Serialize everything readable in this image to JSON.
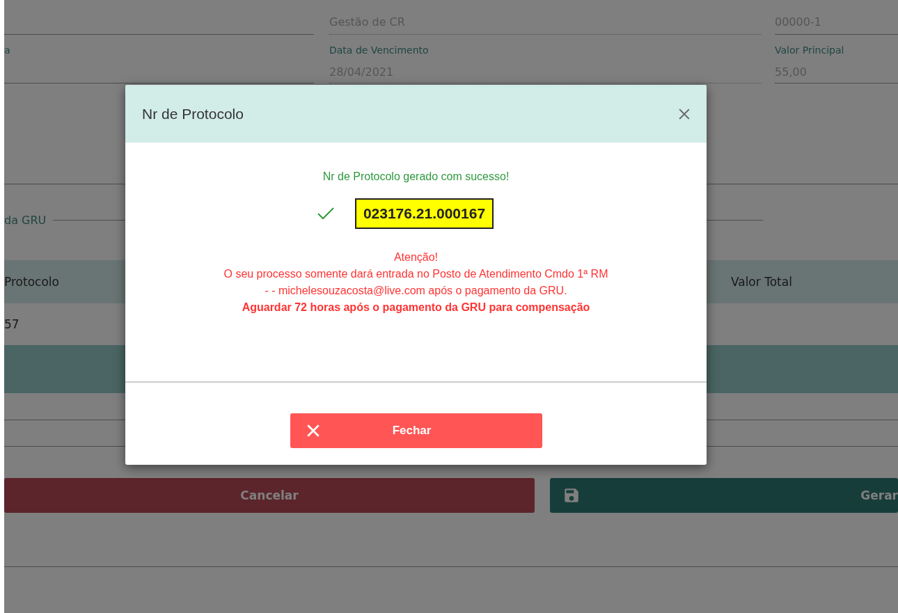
{
  "background_form": {
    "row_1": [
      {
        "value": "Gestão de CR"
      },
      {
        "value": "00000-1"
      }
    ],
    "row_2": [
      {
        "label": "a"
      },
      {
        "label": "Data de Vencimento",
        "value": "28/04/2021"
      },
      {
        "label": "Valor Principal",
        "value": "55,00"
      }
    ],
    "section_legend": "da GRU",
    "table": {
      "columns": [
        "Protocolo",
        "Valor Total"
      ],
      "rows": [
        [
          "57"
        ]
      ]
    },
    "buttons": [
      {
        "kind": "cancel",
        "label": "Cancelar"
      },
      {
        "kind": "save",
        "label": "Gerar"
      }
    ]
  },
  "modal": {
    "title": "Nr de Protocolo",
    "success_message": "Nr de Protocolo gerado com sucesso!",
    "protocol_number": "023176.21.000167",
    "warning_lines": [
      "Atenção!",
      "O seu processo somente dará entrada no Posto de Atendimento Cmdo 1ª RM",
      "- - michelesouzacosta@live.com após o pagamento da GRU."
    ],
    "warning_bold": "Aguardar 72 horas após o pagamento da GRU para compensação",
    "close_button": "Fechar"
  }
}
